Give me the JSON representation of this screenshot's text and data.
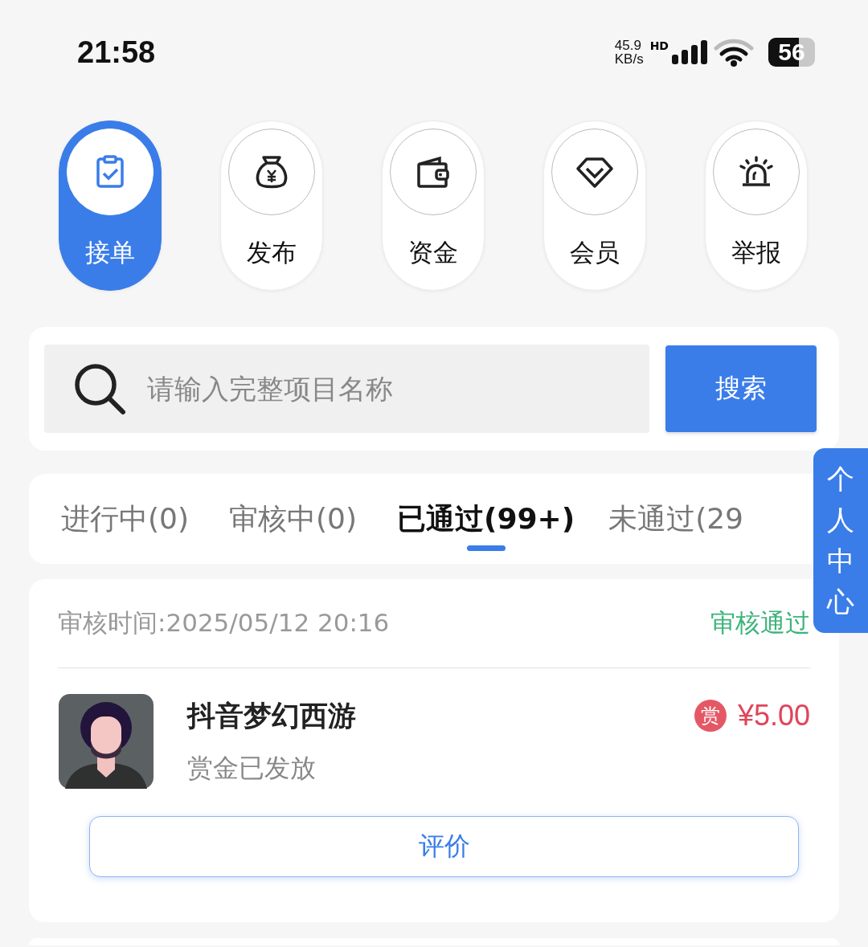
{
  "status_bar": {
    "time": "21:58",
    "net_speed": "45.9",
    "net_unit": "KB/s",
    "network_type": "HD",
    "battery": "56"
  },
  "nav": [
    {
      "label": "接单",
      "selected": true
    },
    {
      "label": "发布",
      "selected": false
    },
    {
      "label": "资金",
      "selected": false
    },
    {
      "label": "会员",
      "selected": false
    },
    {
      "label": "举报",
      "selected": false
    }
  ],
  "search": {
    "placeholder": "请输入完整项目名称",
    "button": "搜索"
  },
  "tabs": [
    {
      "label": "进行中(0)",
      "selected": false
    },
    {
      "label": "审核中(0)",
      "selected": false
    },
    {
      "label": "已通过(99+)",
      "selected": true
    },
    {
      "label": "未通过(29",
      "selected": false
    }
  ],
  "side_tab": "个人中心",
  "records": [
    {
      "review_time": "审核时间:2025/05/12 20:16",
      "status": "审核通过",
      "title": "抖音梦幻西游",
      "subtitle": "赏金已发放",
      "reward_badge": "赏",
      "amount": "¥5.00",
      "button": "评价"
    }
  ]
}
